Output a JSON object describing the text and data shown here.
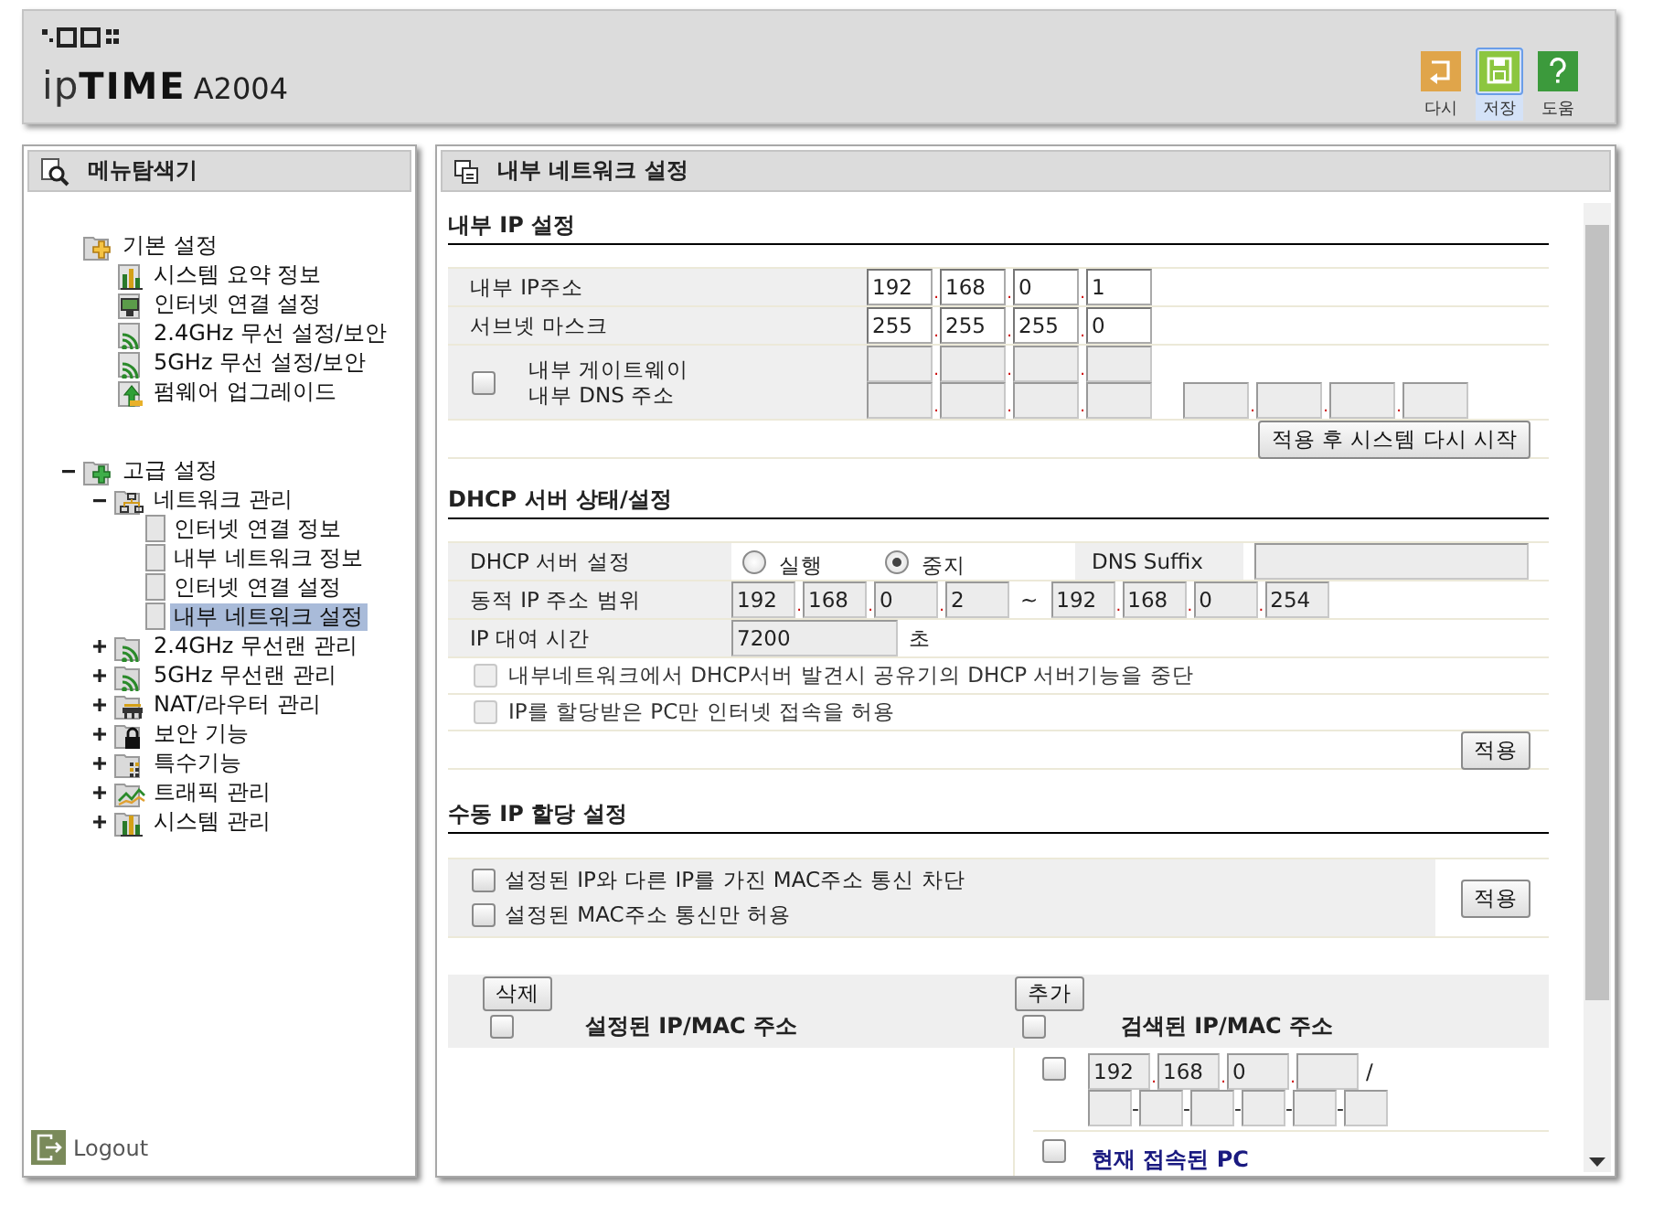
{
  "header": {
    "logo_prefix": "ip",
    "logo_brand": "TIME",
    "model": "A2004",
    "tools": [
      {
        "label": "다시",
        "kind": "undo",
        "selected": false
      },
      {
        "label": "저장",
        "kind": "save",
        "selected": true
      },
      {
        "label": "도움",
        "kind": "help",
        "selected": false
      }
    ]
  },
  "sidebar": {
    "title": "메뉴탐색기",
    "tree": [
      {
        "label": "기본 설정",
        "kind": "basic",
        "children": [
          {
            "label": "시스템 요약 정보",
            "kind": "chart"
          },
          {
            "label": "인터넷 연결 설정",
            "kind": "monitor"
          },
          {
            "label": "2.4GHz 무선 설정/보안",
            "kind": "wifi"
          },
          {
            "label": "5GHz 무선 설정/보안",
            "kind": "wifi"
          },
          {
            "label": "펌웨어 업그레이드",
            "kind": "upgrade"
          }
        ]
      },
      {
        "label": "고급 설정",
        "kind": "advanced",
        "expanded": true,
        "children": [
          {
            "label": "네트워크 관리",
            "kind": "network",
            "expanded": true,
            "children": [
              {
                "label": "인터넷 연결 정보",
                "kind": "page",
                "selected": false
              },
              {
                "label": "내부 네트워크 정보",
                "kind": "page",
                "selected": false
              },
              {
                "label": "인터넷 연결 설정",
                "kind": "page",
                "selected": false
              },
              {
                "label": "내부 네트워크 설정",
                "kind": "page",
                "selected": true
              }
            ]
          },
          {
            "label": "2.4GHz 무선랜 관리",
            "kind": "wifi",
            "expanded": false
          },
          {
            "label": "5GHz 무선랜 관리",
            "kind": "wifi",
            "expanded": false
          },
          {
            "label": "NAT/라우터 관리",
            "kind": "nat",
            "expanded": false
          },
          {
            "label": "보안 기능",
            "kind": "lock",
            "expanded": false
          },
          {
            "label": "특수기능",
            "kind": "special",
            "expanded": false
          },
          {
            "label": "트래픽 관리",
            "kind": "traffic",
            "expanded": false
          },
          {
            "label": "시스템 관리",
            "kind": "chart",
            "expanded": false
          }
        ]
      }
    ],
    "logout": "Logout"
  },
  "main": {
    "title": "내부 네트워크 설정",
    "separators": {
      "ip": ".",
      "mac": "-"
    },
    "internal_ip": {
      "title": "내부 IP 설정",
      "ip_label": "내부 IP주소",
      "ip": [
        "192",
        "168",
        "0",
        "1"
      ],
      "mask_label": "서브넷 마스크",
      "mask": [
        "255",
        "255",
        "255",
        "0"
      ],
      "manual_checked": false,
      "gateway_label": "내부 게이트웨이",
      "dns_label": "내부 DNS 주소",
      "apply": "적용 후 시스템 다시 시작"
    },
    "dhcp": {
      "title": "DHCP 서버 상태/설정",
      "server_label": "DHCP 서버 설정",
      "modes": [
        {
          "label": "실행",
          "selected": false
        },
        {
          "label": "중지",
          "selected": true
        }
      ],
      "dns_suffix_label": "DNS Suffix",
      "range_label": "동적 IP 주소 범위",
      "range_start": [
        "192",
        "168",
        "0",
        "2"
      ],
      "range_sep": "~",
      "range_end": [
        "192",
        "168",
        "0",
        "254"
      ],
      "lease_label": "IP 대여 시간",
      "lease": "7200",
      "lease_unit": "초",
      "options": [
        {
          "label": "내부네트워크에서 DHCP서버 발견시 공유기의 DHCP 서버기능을 중단",
          "checked": false,
          "disabled": true
        },
        {
          "label": "IP를 할당받은 PC만 인터넷 접속을 허용",
          "checked": false,
          "disabled": true
        }
      ],
      "apply": "적용"
    },
    "manual": {
      "title": "수동 IP 할당 설정",
      "options": [
        {
          "label": "설정된 IP와 다른 IP를 가진 MAC주소 통신 차단",
          "checked": false
        },
        {
          "label": "설정된 MAC주소 통신만 허용",
          "checked": false
        }
      ],
      "apply": "적용",
      "configured": {
        "button": "삭제",
        "title": "설정된 IP/MAC 주소",
        "checked": false
      },
      "searched": {
        "button": "추가",
        "title": "검색된 IP/MAC 주소",
        "checked": false,
        "entry": {
          "checked": false,
          "ip": [
            "192",
            "168",
            "0"
          ],
          "slash": "/"
        },
        "current_pc": {
          "label": "현재 접속된 PC",
          "checked": false
        }
      }
    }
  }
}
